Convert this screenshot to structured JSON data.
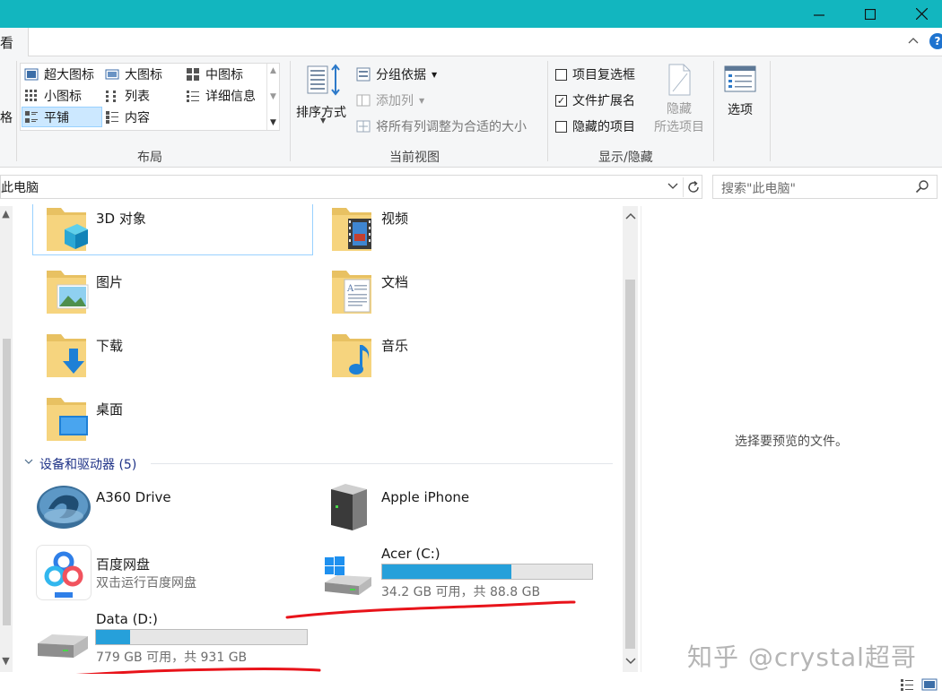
{
  "window": {
    "minimize": "—",
    "maximize": "☐",
    "close": "✕"
  },
  "tabs": {
    "view_label": "看",
    "collapse_glyph": "^",
    "help_glyph": "?"
  },
  "ribbon": {
    "panes_partial": "格",
    "layout": {
      "items": [
        {
          "label": "超大图标",
          "icon": "extra-large-icons-icon"
        },
        {
          "label": "大图标",
          "icon": "large-icons-icon"
        },
        {
          "label": "中图标",
          "icon": "medium-icons-icon"
        },
        {
          "label": "小图标",
          "icon": "small-icons-icon"
        },
        {
          "label": "列表",
          "icon": "list-icon"
        },
        {
          "label": "详细信息",
          "icon": "details-icon"
        },
        {
          "label": "平铺",
          "icon": "tiles-icon",
          "selected": true
        },
        {
          "label": "内容",
          "icon": "content-icon"
        }
      ],
      "group_label": "布局"
    },
    "current_view": {
      "sort_label": "排序方式",
      "group_by_label": "分组依据",
      "add_column_label": "添加列",
      "size_columns_label": "将所有列调整为合适的大小",
      "group_label": "当前视图"
    },
    "show_hide": {
      "item_checkboxes": {
        "label": "项目复选框",
        "checked": false
      },
      "file_extensions": {
        "label": "文件扩展名",
        "checked": true
      },
      "hidden_items": {
        "label": "隐藏的项目",
        "checked": false
      },
      "hide_selected_line1": "隐藏",
      "hide_selected_line2": "所选项目",
      "group_label": "显示/隐藏"
    },
    "options_label": "选项"
  },
  "address": {
    "path": "此电脑",
    "search_placeholder": "搜索\"此电脑\""
  },
  "folders": [
    {
      "name": "3D 对象",
      "icon": "3d-objects-folder-icon"
    },
    {
      "name": "视频",
      "icon": "videos-folder-icon"
    },
    {
      "name": "图片",
      "icon": "pictures-folder-icon"
    },
    {
      "name": "文档",
      "icon": "documents-folder-icon"
    },
    {
      "name": "下载",
      "icon": "downloads-folder-icon"
    },
    {
      "name": "音乐",
      "icon": "music-folder-icon"
    },
    {
      "name": "桌面",
      "icon": "desktop-folder-icon"
    }
  ],
  "devices": {
    "header": "设备和驱动器 (5)",
    "items": [
      {
        "name": "A360 Drive",
        "icon": "a360-drive-icon"
      },
      {
        "name": "Apple iPhone",
        "icon": "iphone-device-icon"
      },
      {
        "name": "百度网盘",
        "sub": "双击运行百度网盘",
        "icon": "baidu-netdisk-icon"
      },
      {
        "name": "Acer (C:)",
        "sub": "34.2 GB 可用，共 88.8 GB",
        "used_fraction": 0.615,
        "icon": "windows-drive-icon"
      },
      {
        "name": "Data (D:)",
        "sub": "779 GB 可用，共 931 GB",
        "used_fraction": 0.163,
        "icon": "hard-drive-icon"
      }
    ]
  },
  "preview": {
    "empty_text": "选择要预览的文件。"
  },
  "watermark": "知乎 @crystal超哥",
  "colors": {
    "titlebar": "#12b6bf",
    "drive_fill": "#26a0da",
    "annotation": "#e8131a"
  }
}
